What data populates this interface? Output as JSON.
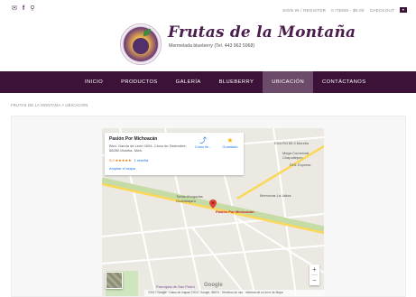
{
  "topbar": {
    "icons": [
      "mail-icon",
      "facebook-icon",
      "search-icon"
    ],
    "account_link": "SIGN IN / REGISTER",
    "cart_summary": "0 ITEMS - $0.00",
    "checkout": "CHECKOUT"
  },
  "brand": {
    "title": "Frutas de la Montaña",
    "subtitle": "Mermelada blueberry (Tel. 443 962 5968)"
  },
  "nav": {
    "items": [
      "INICIO",
      "PRODUCTOS",
      "GALERÍA",
      "BLUEBERRY",
      "UBICACIÓN",
      "CONTÁCTANOS"
    ],
    "active": "UBICACIÓN",
    "background": "#3c1239",
    "active_background": "#6b4a6a"
  },
  "breadcrumb": "FRUTAS DE LA MONTAÑA > UBICACIÓN",
  "map": {
    "place": {
      "name": "Pasión Por Michoacán",
      "address": "Blvd. García de León 1694, Cinco de Diciembre, 58280 Morelia, Mich.",
      "rating": "5,0 ★★★★★",
      "reviews": "1 reseña",
      "larger_map": "Ampliar el mapa",
      "directions": "Cómo lle...",
      "save": "Guardado"
    },
    "labels": {
      "pin": "Pasión Por Michoacán",
      "exa": "EXA FM 89.3 Morelia",
      "mega": "Mega Comercial Chapultepec",
      "dhl": "DHL Express",
      "memorias": "Memorias La Jalisa",
      "tortas": "Tortas Ahogadas Guadalajara",
      "parroquia": "Parroquia de San Pedro Apóstol",
      "google": "Google",
      "footer": "©2017 Google · Datos de mapas ©2017 Google, INEGI · Términos de uso · Informar de un error de Mapa"
    },
    "zoom_in": "+",
    "zoom_out": "−"
  }
}
